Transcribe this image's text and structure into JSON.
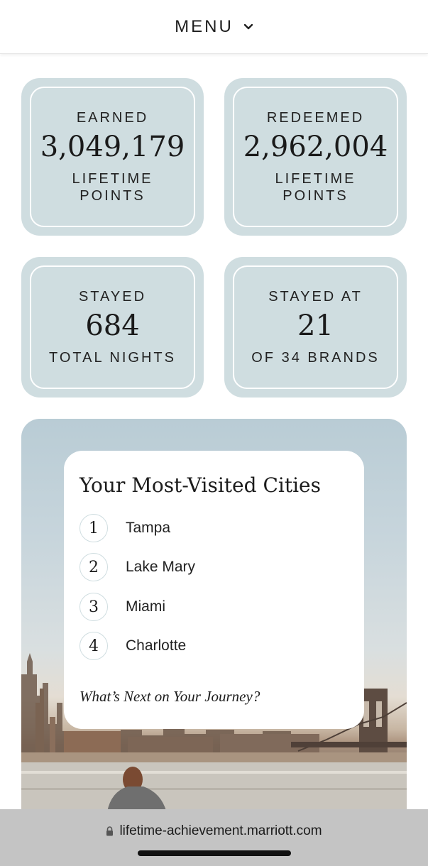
{
  "header": {
    "menu_label": "MENU",
    "menu_icon": "chevron-down-icon"
  },
  "stats": [
    {
      "label": "EARNED",
      "value": "3,049,179",
      "sub_line1": "LIFETIME",
      "sub_line2": "POINTS"
    },
    {
      "label": "REDEEMED",
      "value": "2,962,004",
      "sub_line1": "LIFETIME",
      "sub_line2": "POINTS"
    },
    {
      "label": "STAYED",
      "value": "684",
      "sub_line1": "TOTAL NIGHTS"
    },
    {
      "label": "STAYED AT",
      "value": "21",
      "sub_line1": "OF 34 BRANDS"
    }
  ],
  "cities": {
    "title": "Your Most-Visited Cities",
    "items": [
      {
        "rank": "1",
        "name": "Tampa"
      },
      {
        "rank": "2",
        "name": "Lake Mary"
      },
      {
        "rank": "3",
        "name": "Miami"
      },
      {
        "rank": "4",
        "name": "Charlotte"
      }
    ],
    "cta": "What’s Next on Your Journey?"
  },
  "browser": {
    "url": "lifetime-achievement.marriott.com",
    "lock_icon": "lock-icon"
  },
  "colors": {
    "card_bg": "#cfdde0",
    "card_border": "#ffffff",
    "text": "#1c1c1c"
  }
}
